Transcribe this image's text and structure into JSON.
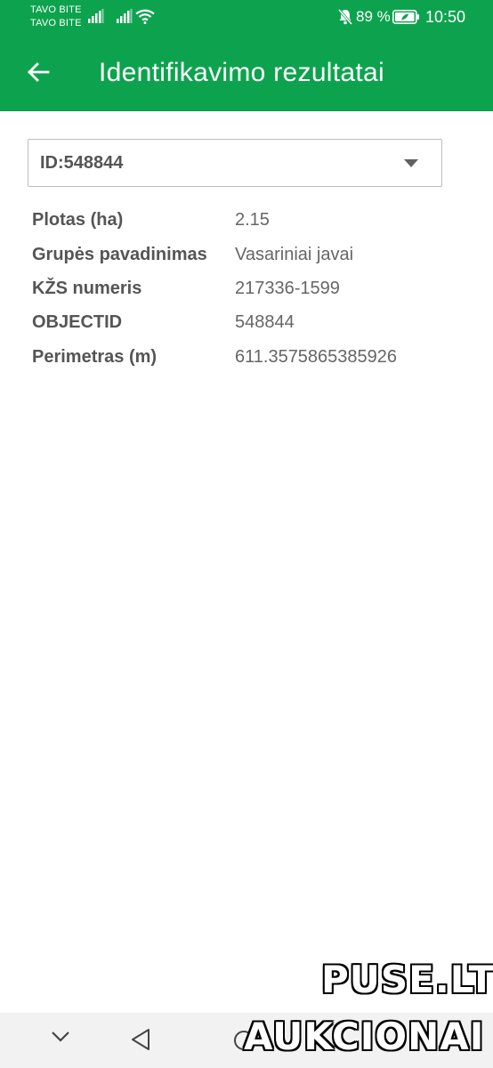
{
  "statusbar": {
    "carrier1": "TAVO BITE",
    "carrier2": "TAVO BITE",
    "battery_percent": "89 %",
    "time": "10:50",
    "icons": [
      "signal-icon",
      "signal-icon",
      "wifi-icon",
      "bell-muted-icon",
      "battery-icon"
    ]
  },
  "appbar": {
    "title": "Identifikavimo rezultatai",
    "back_icon": "arrow-left-icon"
  },
  "dropdown": {
    "selected": "ID:548844",
    "icon": "chevron-down-icon"
  },
  "attributes": [
    {
      "label": "Plotas (ha)",
      "value": "2.15"
    },
    {
      "label": "Grupės pavadinimas",
      "value": "Vasariniai javai"
    },
    {
      "label": "KŽS numeris",
      "value": "217336-1599"
    },
    {
      "label": "OBJECTID",
      "value": "548844"
    },
    {
      "label": "Perimetras (m)",
      "value": "611.3575865385926"
    }
  ],
  "navbar": {
    "icons": [
      "chevron-down-icon",
      "triangle-back-icon",
      "circle-home-icon"
    ]
  },
  "watermark": {
    "line1": "PUSE.LT",
    "line2": "AUKCIONAI"
  },
  "colors": {
    "primary": "#0da34e",
    "label_text": "#555555",
    "value_text": "#666666"
  }
}
